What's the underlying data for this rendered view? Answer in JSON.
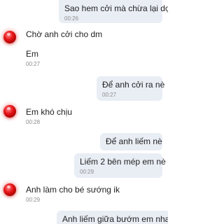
{
  "messages": [
    {
      "text": "Sao hem cởi mà chừa lại dợ",
      "time": "00:26"
    },
    {
      "text": "Chờ anh cởi cho dm",
      "time": ""
    },
    {
      "text": "Em",
      "time": "00:27"
    },
    {
      "text": "Để anh cởi ra nè",
      "time": "00:27"
    },
    {
      "text": "Em khó chịu",
      "time": "00:28"
    },
    {
      "text": "Để anh liếm nè",
      "time": ""
    },
    {
      "text": "Liếm 2 bên mép em nè",
      "time": "00:29"
    },
    {
      "text": "Anh làm cho bé sướng ik",
      "time": "00:29"
    },
    {
      "text": "Anh liếm giữa bướm em nha",
      "time": ""
    }
  ],
  "colors": {
    "incoming_bubble": "#ffffff",
    "outgoing_bubble": "#e9eef5",
    "avatar": "#e8191c",
    "timestamp": "#8c8c8c"
  }
}
